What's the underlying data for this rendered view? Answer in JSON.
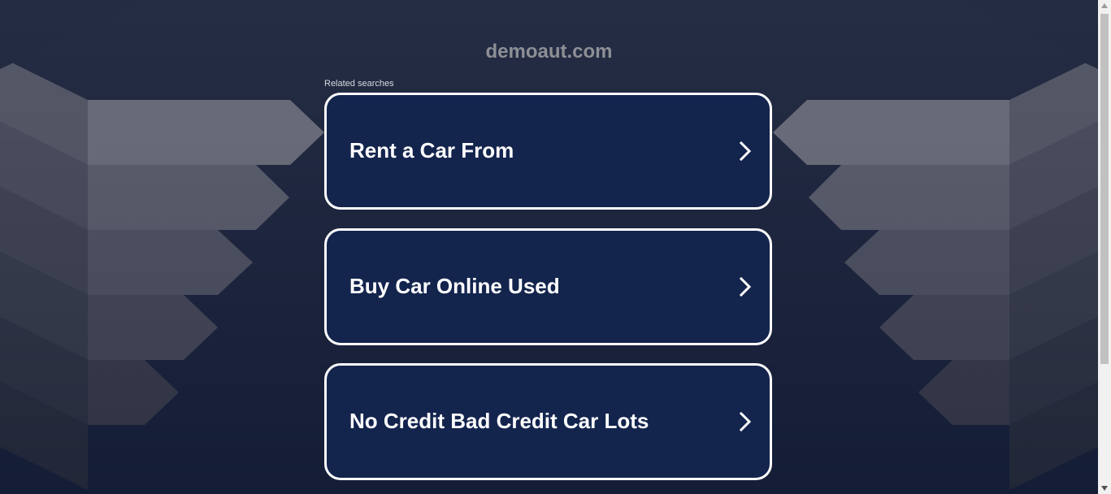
{
  "site": {
    "domain": "demoaut.com"
  },
  "related": {
    "label": "Related searches",
    "items": [
      "Rent a Car From",
      "Buy Car Online Used",
      "No Credit Bad Credit Car Lots"
    ]
  },
  "icons": {
    "chevron": "chevron-right-icon",
    "scroll_up": "triangle-up-icon",
    "scroll_down": "triangle-down-icon"
  },
  "colors": {
    "background": "#121b34",
    "card_background": "#13244d",
    "card_border": "#ffffff",
    "title_text": "#8d8f95",
    "scrollbar_track": "#f1f1f1",
    "scrollbar_thumb": "#c1c1c1"
  }
}
